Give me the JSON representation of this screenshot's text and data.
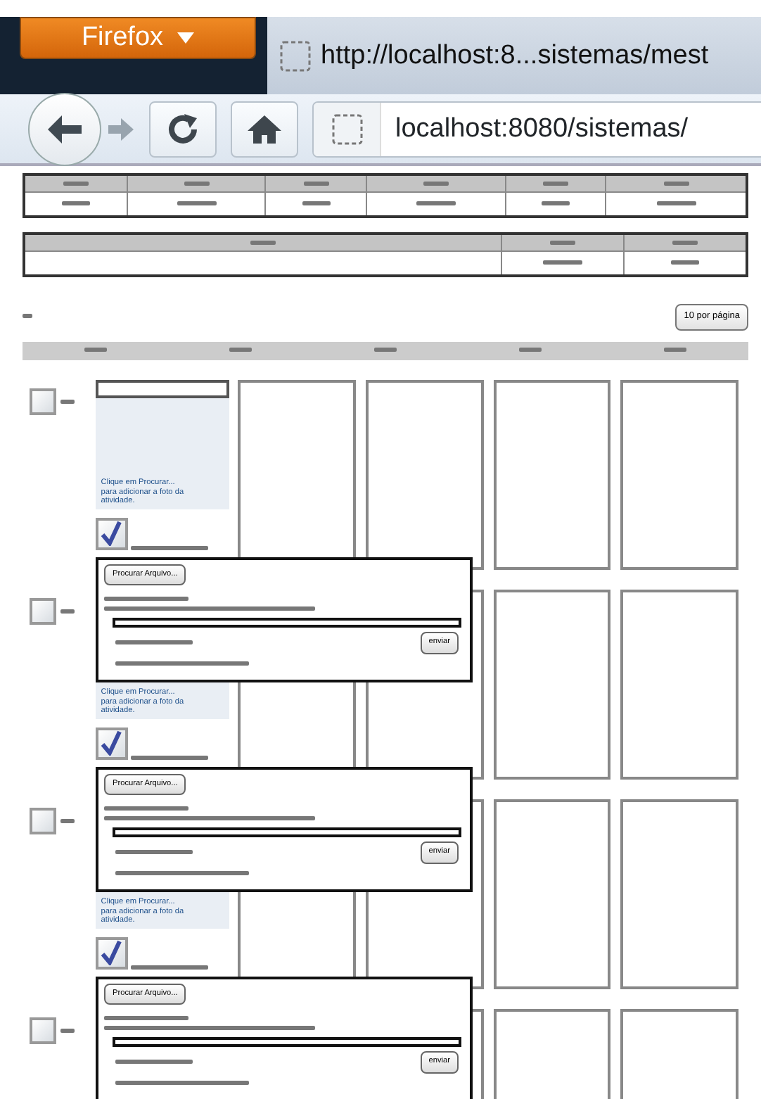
{
  "browser": {
    "menu_button": "Firefox",
    "tab_title": "http://localhost:8...sistemas/mest",
    "address": "localhost:8080/sistemas/",
    "forward_disabled": true
  },
  "per_page_button": "10 por página",
  "rows": [
    {
      "selected": false,
      "photo_hint": "Clique em Procurar... para adicionar a foto da atividade.",
      "photo_checked": true
    },
    {
      "selected": false,
      "photo_hint": "Clique em Procurar... para adicionar a foto da atividade.",
      "photo_checked": true
    },
    {
      "selected": false,
      "photo_hint": "Clique em Procurar... para adicionar a foto da atividade.",
      "photo_checked": true
    },
    {
      "selected": false
    }
  ],
  "upload_panels": [
    {
      "browse_button": "Procurar Arquivo...",
      "send_button": "enviar"
    },
    {
      "browse_button": "Procurar Arquivo...",
      "send_button": "enviar"
    },
    {
      "browse_button": "Procurar Arquivo...",
      "send_button": "enviar"
    }
  ]
}
